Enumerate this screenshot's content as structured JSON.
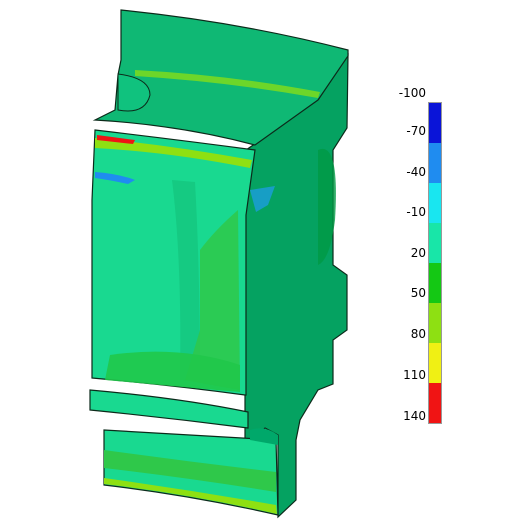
{
  "legend": {
    "labels": [
      "-100",
      "-70",
      "-40",
      "-10",
      "20",
      "50",
      "80",
      "110",
      "140"
    ],
    "colors": [
      "#0a14d8",
      "#1f8cf0",
      "#19e6f0",
      "#18e6a8",
      "#14c814",
      "#8ee012",
      "#f0f014",
      "#f01414"
    ]
  },
  "model": {
    "base_color": "#00a86a",
    "face_color": "#19d990",
    "edge_color": "#0c2a1a"
  }
}
